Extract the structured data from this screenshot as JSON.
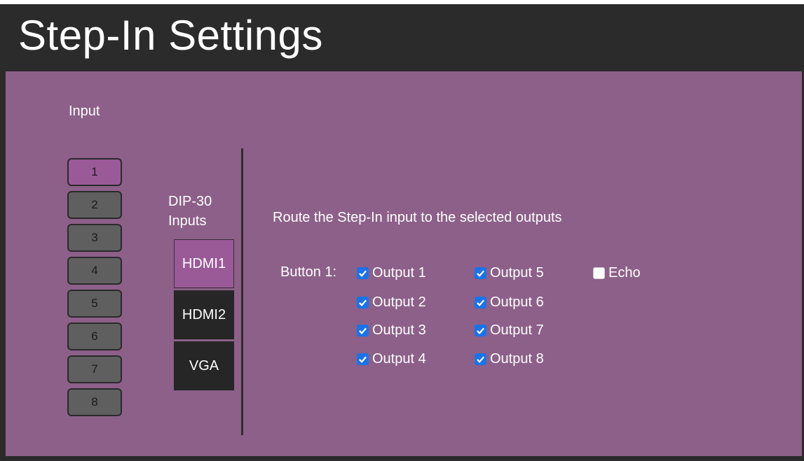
{
  "header": {
    "title": "Step-In Settings"
  },
  "input_section": {
    "label": "Input",
    "buttons": [
      {
        "label": "1",
        "active": true
      },
      {
        "label": "2",
        "active": false
      },
      {
        "label": "3",
        "active": false
      },
      {
        "label": "4",
        "active": false
      },
      {
        "label": "5",
        "active": false
      },
      {
        "label": "6",
        "active": false
      },
      {
        "label": "7",
        "active": false
      },
      {
        "label": "8",
        "active": false
      }
    ]
  },
  "dip": {
    "label_line1": "DIP-30",
    "label_line2": "Inputs",
    "sources": [
      {
        "label": "HDMI1",
        "active": true
      },
      {
        "label": "HDMI2",
        "active": false
      },
      {
        "label": "VGA",
        "active": false
      }
    ]
  },
  "routing": {
    "instruction": "Route the Step-In input to the selected outputs",
    "button_label": "Button 1:",
    "outputs": [
      {
        "label": "Output 1",
        "checked": true
      },
      {
        "label": "Output 2",
        "checked": true
      },
      {
        "label": "Output 3",
        "checked": true
      },
      {
        "label": "Output 4",
        "checked": true
      },
      {
        "label": "Output 5",
        "checked": true
      },
      {
        "label": "Output 6",
        "checked": true
      },
      {
        "label": "Output 7",
        "checked": true
      },
      {
        "label": "Output 8",
        "checked": true
      }
    ],
    "echo": {
      "label": "Echo",
      "checked": false
    }
  },
  "colors": {
    "panel": "#8c6089",
    "active_button": "#9a5a98",
    "inactive_button": "#5f5f5f",
    "checkbox_accent": "#1a73e8",
    "header_bg": "#2b2b2b"
  }
}
